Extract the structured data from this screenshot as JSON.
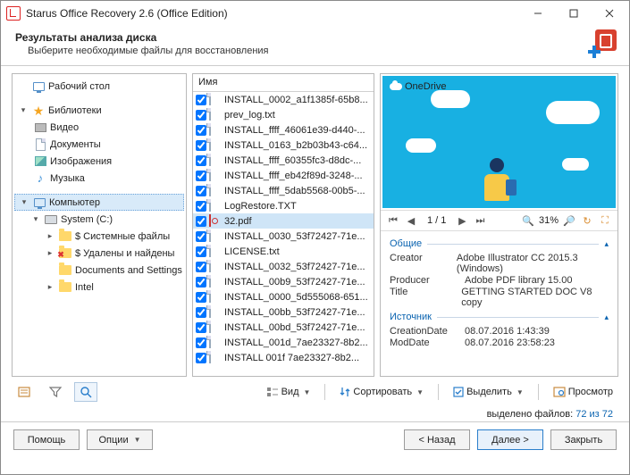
{
  "window": {
    "title": "Starus Office Recovery 2.6 (Office Edition)"
  },
  "header": {
    "title": "Результаты анализа диска",
    "subtitle": "Выберите необходимые файлы для восстановления"
  },
  "tree": {
    "desktop": "Рабочий стол",
    "libraries": "Библиотеки",
    "video": "Видео",
    "documents": "Документы",
    "images": "Изображения",
    "music": "Музыка",
    "computer": "Компьютер",
    "system": "System (C:)",
    "sysfiles": "$ Системные файлы",
    "deleted": "$ Удалены и найдены",
    "docs": "Documents and Settings",
    "intel": "Intel"
  },
  "filesHeader": "Имя",
  "files": [
    "INSTALL_0002_a1f1385f-65b8...",
    "prev_log.txt",
    "INSTALL_ffff_46061e39-d440-...",
    "INSTALL_0163_b2b03b43-c64...",
    "INSTALL_ffff_60355fc3-d8dc-...",
    "INSTALL_ffff_eb42f89d-3248-...",
    "INSTALL_ffff_5dab5568-00b5-...",
    "LogRestore.TXT",
    "32.pdf",
    "INSTALL_0030_53f72427-71e...",
    "LICENSE.txt",
    "INSTALL_0032_53f72427-71e...",
    "INSTALL_00b9_53f72427-71e...",
    "INSTALL_0000_5d555068-651...",
    "INSTALL_00bb_53f72427-71e...",
    "INSTALL_00bd_53f72427-71e...",
    "INSTALL_001d_7ae23327-8b2...",
    "INSTALL  001f  7ae23327-8b2..."
  ],
  "selectedFile": 8,
  "preview": {
    "onedrive": "OneDrive",
    "page": "1 / 1",
    "zoom": "31%",
    "section_general": "Общие",
    "section_source": "Источник",
    "creator_l": "Creator",
    "creator_v": "Adobe Illustrator CC 2015.3 (Windows)",
    "producer_l": "Producer",
    "producer_v": "Adobe PDF library 15.00",
    "title_l": "Title",
    "title_v": "GETTING STARTED DOC V8 copy",
    "cdate_l": "CreationDate",
    "cdate_v": "08.07.2016 1:43:39",
    "mdate_l": "ModDate",
    "mdate_v": "08.07.2016 23:58:23"
  },
  "toolbar": {
    "view": "Вид",
    "sort": "Сортировать",
    "select": "Выделить",
    "preview": "Просмотр"
  },
  "status": {
    "label": "выделено файлов:",
    "count": "72 из 72"
  },
  "footer": {
    "help": "Помощь",
    "options": "Опции",
    "back": "< Назад",
    "next": "Далее >",
    "close": "Закрыть"
  }
}
